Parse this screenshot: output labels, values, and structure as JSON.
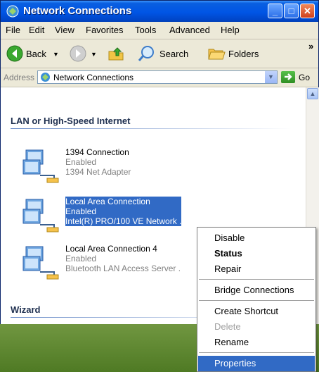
{
  "window": {
    "title": "Network Connections",
    "minimize_glyph": "_",
    "maximize_glyph": "□",
    "close_glyph": "✕"
  },
  "menubar": {
    "items": [
      "File",
      "Edit",
      "View",
      "Favorites",
      "Tools",
      "Advanced",
      "Help"
    ]
  },
  "toolbar": {
    "back_label": "Back",
    "search_label": "Search",
    "folders_label": "Folders",
    "overflow": "»"
  },
  "address": {
    "label": "Address",
    "value": "Network Connections",
    "go_label": "Go"
  },
  "content": {
    "group_heading": "LAN or High-Speed Internet",
    "connections": [
      {
        "name": "1394 Connection",
        "status": "Enabled",
        "device": "1394 Net Adapter"
      },
      {
        "name": "Local Area Connection",
        "status": "Enabled",
        "device": "Intel(R) PRO/100 VE Network ."
      },
      {
        "name": "Local Area Connection 4",
        "status": "Enabled",
        "device": "Bluetooth LAN Access Server ."
      }
    ],
    "wizard_heading": "Wizard"
  },
  "context_menu": {
    "items": [
      "Disable",
      "Status",
      "Repair",
      "Bridge Connections",
      "Create Shortcut",
      "Delete",
      "Rename",
      "Properties"
    ]
  },
  "colors": {
    "title_blue": "#0055e5",
    "selection": "#316ac5",
    "menu_bg": "#ece9d8"
  }
}
